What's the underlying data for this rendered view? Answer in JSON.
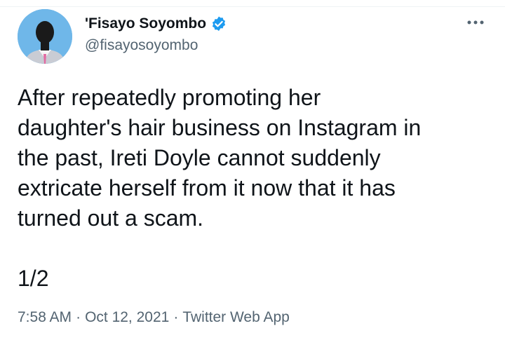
{
  "author": {
    "display_name": "'Fisayo Soyombo",
    "handle": "@fisayosoyombo",
    "verified_icon": "verified-badge-icon",
    "avatar_icon": "avatar"
  },
  "more_icon": "more-horizontal-icon",
  "tweet": {
    "text": "After repeatedly promoting her\ndaughter's hair business on Instagram in\nthe past, Ireti Doyle cannot suddenly\nextricate herself from it now that it has\nturned out a scam.\n\n1/2"
  },
  "meta": {
    "time": "7:58 AM",
    "date": "Oct 12, 2021",
    "source": "Twitter Web App",
    "separator": "·"
  },
  "colors": {
    "accent": "#1d9bf0",
    "secondary_text": "#536471",
    "primary_text": "#0f1419"
  }
}
